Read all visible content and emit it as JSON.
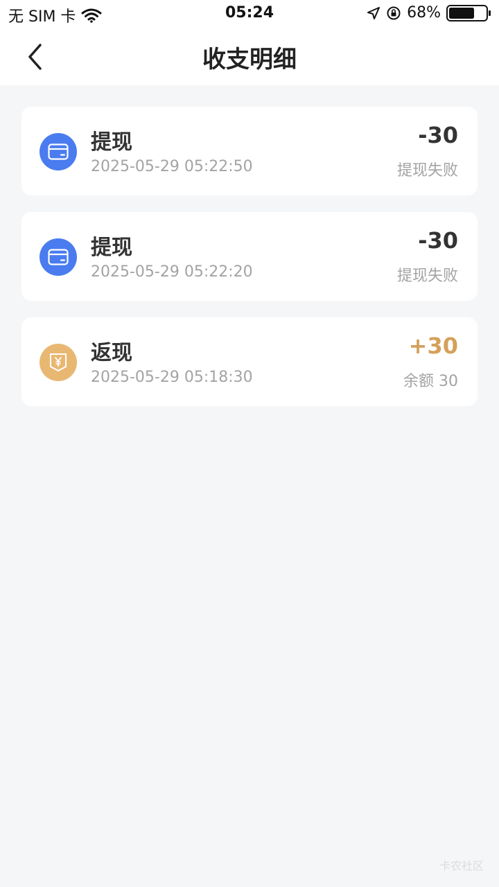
{
  "status_bar": {
    "carrier": "无 SIM 卡",
    "time": "05:24",
    "battery": "68%"
  },
  "nav": {
    "title": "收支明细"
  },
  "records": [
    {
      "title": "提现",
      "time": "2025-05-29 05:22:50",
      "amount": "-30",
      "status": "提现失败",
      "icon": "card-icon",
      "icon_color": "#4a7cf0"
    },
    {
      "title": "提现",
      "time": "2025-05-29 05:22:20",
      "amount": "-30",
      "status": "提现失败",
      "icon": "card-icon",
      "icon_color": "#4a7cf0"
    },
    {
      "title": "返现",
      "time": "2025-05-29 05:18:30",
      "amount": "+30",
      "status": "余额 30",
      "icon": "yuan-icon",
      "icon_color": "#e8b872",
      "amount_color": "#d4a15a"
    }
  ],
  "watermark": "卡农社区"
}
